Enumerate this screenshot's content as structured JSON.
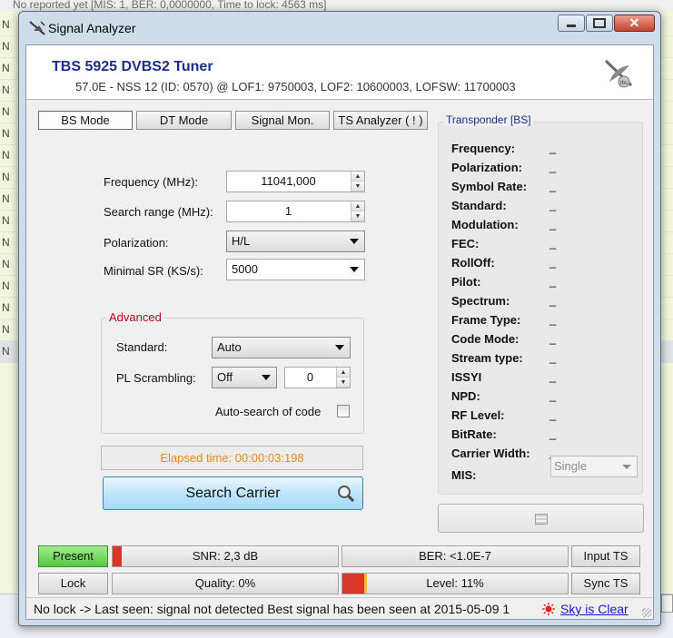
{
  "background": {
    "topline": "No reported yet [MIS: 1, BER: 0,0000000, Time to lock: 4563 ms]",
    "row_letters": [
      "N",
      "N",
      "N",
      "N",
      "N",
      "N",
      "N",
      "N",
      "N",
      "N",
      "N",
      "N",
      "N",
      "N",
      "N",
      "N"
    ]
  },
  "window": {
    "title": "Signal Analyzer",
    "minimize": "▭",
    "close": "✕"
  },
  "header": {
    "title": "TBS 5925 DVBS2 Tuner",
    "subtitle": "57.0E - NSS 12 (ID: 0570) @ LOF1: 9750003, LOF2: 10600003, LOFSW: 11700003",
    "logo_icon": "satellite-dish-icon"
  },
  "tabs": [
    {
      "label": "BS Mode",
      "active": true
    },
    {
      "label": "DT Mode",
      "active": false
    },
    {
      "label": "Signal Mon.",
      "active": false
    },
    {
      "label": "TS Analyzer ( ! )",
      "active": false
    }
  ],
  "form": {
    "frequency_label": "Frequency (MHz):",
    "frequency_value": "11041,000",
    "search_range_label": "Search range (MHz):",
    "search_range_value": "1",
    "polarization_label": "Polarization:",
    "polarization_value": "H/L",
    "min_sr_label": "Minimal SR (KS/s):",
    "min_sr_value": "5000"
  },
  "advanced": {
    "title": "Advanced",
    "standard_label": "Standard:",
    "standard_value": "Auto",
    "pl_label": "PL Scrambling:",
    "pl_value": "Off",
    "pl_number": "0",
    "autosearch_label": "Auto-search of code",
    "autosearch_checked": false
  },
  "elapsed": "Elapsed time: 00:00:03:198",
  "search_button": "Search Carrier",
  "transponder": {
    "title": "Transponder [BS]",
    "fields": [
      {
        "label": "Frequency:",
        "value": "_"
      },
      {
        "label": "Polarization:",
        "value": "_"
      },
      {
        "label": "Symbol Rate:",
        "value": "_"
      },
      {
        "label": "Standard:",
        "value": "_"
      },
      {
        "label": "Modulation:",
        "value": "_"
      },
      {
        "label": "FEC:",
        "value": "_"
      },
      {
        "label": "RollOff:",
        "value": "_"
      },
      {
        "label": "Pilot:",
        "value": "_"
      },
      {
        "label": "Spectrum:",
        "value": "_"
      },
      {
        "label": "Frame Type:",
        "value": "_"
      },
      {
        "label": "Code Mode:",
        "value": "_"
      },
      {
        "label": "Stream type:",
        "value": "_"
      },
      {
        "label": "ISSYI",
        "value": "_"
      },
      {
        "label": "NPD:",
        "value": "_"
      },
      {
        "label": "RF Level:",
        "value": "_"
      },
      {
        "label": "BitRate:",
        "value": "_"
      },
      {
        "label": "Carrier Width:",
        "value": "_"
      }
    ],
    "mis_label": "MIS:",
    "mis_value": "Single"
  },
  "status": {
    "present": "Present",
    "snr": "SNR: 2,3 dB",
    "snr_level": 0.04,
    "ber": "BER: <1.0E-7",
    "input_ts": "Input TS",
    "lock": "Lock",
    "quality": "Quality: 0%",
    "level": "Level: 11%",
    "level_value": 0.11,
    "sync_ts": "Sync TS",
    "colors": {
      "present": "#55c83f",
      "snr_fill": "#d9362b",
      "level_fill": "#d9362b",
      "level_marker": "#f0c030"
    }
  },
  "statusbar": {
    "message": "No lock -> Last seen: signal not detected  Best signal has been seen at 2015-05-09 1",
    "sky_link": "Sky is Clear",
    "sky_icon": "sun-icon"
  }
}
